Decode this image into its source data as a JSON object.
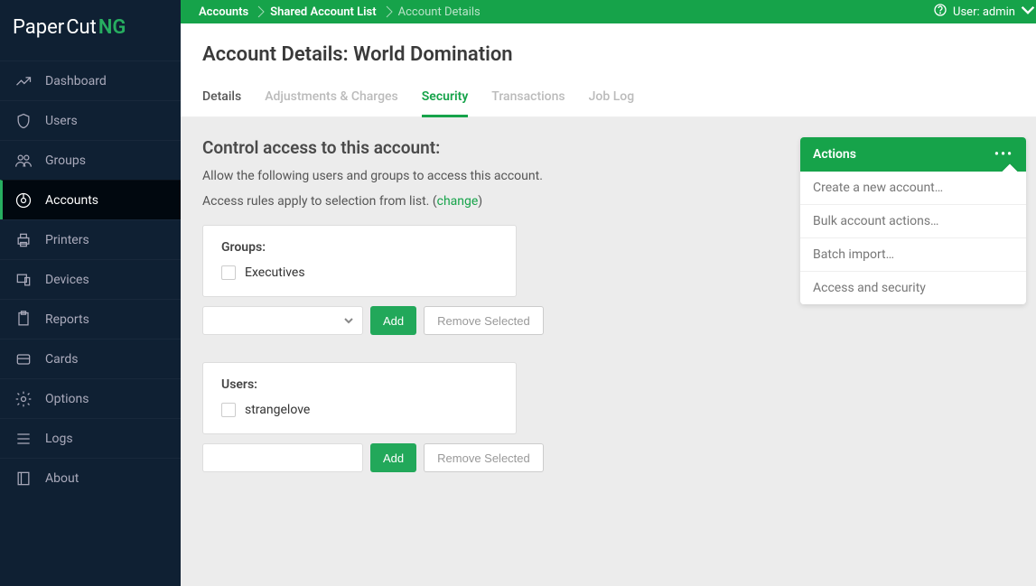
{
  "brand": {
    "paper": "Paper",
    "cut": "Cut",
    "ng": "NG"
  },
  "sidebar": {
    "items": [
      {
        "label": "Dashboard"
      },
      {
        "label": "Users"
      },
      {
        "label": "Groups"
      },
      {
        "label": "Accounts"
      },
      {
        "label": "Printers"
      },
      {
        "label": "Devices"
      },
      {
        "label": "Reports"
      },
      {
        "label": "Cards"
      },
      {
        "label": "Options"
      },
      {
        "label": "Logs"
      },
      {
        "label": "About"
      }
    ]
  },
  "breadcrumb": {
    "items": [
      {
        "label": "Accounts"
      },
      {
        "label": "Shared Account List"
      },
      {
        "label": "Account Details"
      }
    ]
  },
  "user": {
    "label": "User: admin"
  },
  "page": {
    "title": "Account Details: World Domination"
  },
  "tabs": {
    "items": [
      {
        "label": "Details"
      },
      {
        "label": "Adjustments & Charges"
      },
      {
        "label": "Security"
      },
      {
        "label": "Transactions"
      },
      {
        "label": "Job Log"
      }
    ]
  },
  "security": {
    "heading": "Control access to this account:",
    "desc": "Allow the following users and groups to access this account.",
    "rules_prefix": "Access rules apply to selection from list. (",
    "rules_link": "change",
    "rules_suffix": ")",
    "groups": {
      "title": "Groups:",
      "items": [
        {
          "label": "Executives"
        }
      ],
      "add": "Add",
      "remove": "Remove Selected"
    },
    "users": {
      "title": "Users:",
      "items": [
        {
          "label": "strangelove"
        }
      ],
      "add": "Add",
      "remove": "Remove Selected"
    }
  },
  "actions": {
    "title": "Actions",
    "items": [
      {
        "label": "Create a new account…"
      },
      {
        "label": "Bulk account actions…"
      },
      {
        "label": "Batch import…"
      },
      {
        "label": "Access and security"
      }
    ]
  }
}
